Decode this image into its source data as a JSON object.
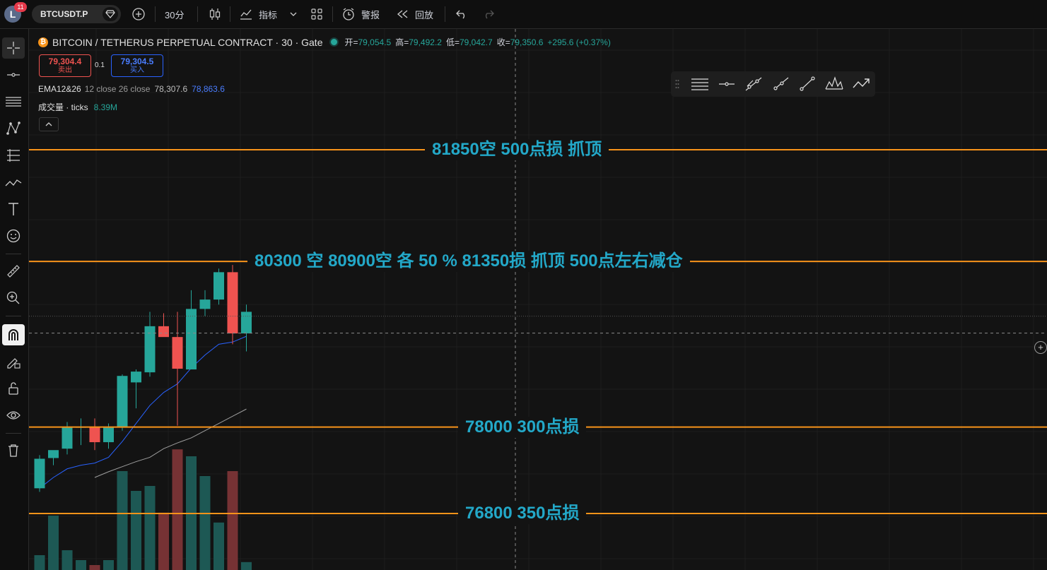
{
  "topbar": {
    "avatar_letter": "L",
    "notification_count": "11",
    "symbol": "BTCUSDT.P",
    "interval": "30分",
    "indicators_label": "指标",
    "alert_label": "警报",
    "replay_label": "回放"
  },
  "legend": {
    "coin_icon": "bitcoin-coin-icon",
    "title": "BITCOIN / TETHERUS PERPETUAL CONTRACT · 30 · Gate",
    "open_label": "开=",
    "open": "79,054.5",
    "high_label": "高=",
    "high": "79,492.2",
    "low_label": "低=",
    "low": "79,042.7",
    "close_label": "收=",
    "close": "79,350.6",
    "change": "+295.6 (+0.37%)",
    "sell_price": "79,304.4",
    "sell_label": "卖出",
    "spread": "0.1",
    "buy_price": "79,304.5",
    "buy_label": "买入",
    "ema_name": "EMA12&26",
    "ema_params": "12 close 26 close",
    "ema_value_1": "78,307.6",
    "ema_value_2": "78,863.6",
    "volume_name": "成交量 · ticks",
    "volume_value": "8.39M"
  },
  "annotations": [
    {
      "text": "81850空   500点损  抓顶",
      "price": 81850
    },
    {
      "text": "80300  空   80900空  各 50 %     81350损   抓顶 500点左右减仓",
      "price": 80300
    },
    {
      "text": "78000    300点损",
      "price": 78000
    },
    {
      "text": "76800    350点损",
      "price": 76800
    }
  ],
  "colors": {
    "background": "#131313",
    "up": "#26a69a",
    "down": "#ef5350",
    "annotation_line": "#f7931a",
    "annotation_text": "#23a8c8",
    "ema_fast": "#2962ff",
    "ema_slow": "#9e9e9e"
  },
  "chart_data": {
    "type": "candlestick",
    "ohlc": [
      {
        "o": 77150,
        "h": 77610,
        "l": 77100,
        "c": 77560
      },
      {
        "o": 77570,
        "h": 77660,
        "l": 77470,
        "c": 77680
      },
      {
        "o": 77700,
        "h": 78070,
        "l": 77620,
        "c": 78000
      },
      {
        "o": 78000,
        "h": 78120,
        "l": 77750,
        "c": 78000
      },
      {
        "o": 78000,
        "h": 78120,
        "l": 77680,
        "c": 77790
      },
      {
        "o": 77790,
        "h": 78050,
        "l": 77700,
        "c": 78000
      },
      {
        "o": 78000,
        "h": 78730,
        "l": 77950,
        "c": 78710
      },
      {
        "o": 78620,
        "h": 78800,
        "l": 78260,
        "c": 78770
      },
      {
        "o": 78760,
        "h": 79600,
        "l": 78700,
        "c": 79400
      },
      {
        "o": 79400,
        "h": 79580,
        "l": 79280,
        "c": 79250
      },
      {
        "o": 79250,
        "h": 79600,
        "l": 78020,
        "c": 78810
      },
      {
        "o": 78800,
        "h": 79900,
        "l": 78800,
        "c": 79640
      },
      {
        "o": 79640,
        "h": 79900,
        "l": 79540,
        "c": 79770
      },
      {
        "o": 79770,
        "h": 80200,
        "l": 79700,
        "c": 80150
      },
      {
        "o": 80150,
        "h": 80250,
        "l": 79150,
        "c": 79300
      },
      {
        "o": 79300,
        "h": 79700,
        "l": 79050,
        "c": 79600
      }
    ],
    "volume": [
      0,
      0,
      0,
      0,
      0,
      0,
      0,
      0,
      0,
      0,
      0,
      0,
      0,
      0,
      0,
      0
    ],
    "volume_levels": [
      0.15,
      0.55,
      0.2,
      0.1,
      0.05,
      0.1,
      1.0,
      0.8,
      0.85,
      0.58,
      1.22,
      1.15,
      0.95,
      0.48,
      1.0,
      0.08
    ],
    "ema_fast": [
      77150,
      77300,
      77420,
      77470,
      77500,
      77580,
      77800,
      78050,
      78300,
      78480,
      78600,
      78820,
      79000,
      79150,
      79180,
      79260
    ],
    "ema_slow": [
      null,
      null,
      null,
      null,
      77300,
      77380,
      77450,
      77520,
      77580,
      77700,
      77780,
      77850,
      77950,
      78050,
      78150,
      78250
    ],
    "current_price": 79304.5
  }
}
